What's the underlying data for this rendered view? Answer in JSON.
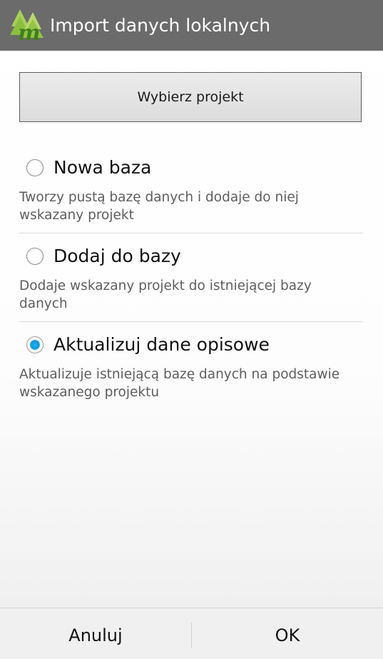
{
  "dialog": {
    "title": "Import danych lokalnych",
    "logo_icon": "trees-m-logo-icon",
    "choose_project_label": "Wybierz projekt"
  },
  "options": [
    {
      "label": "Nowa baza",
      "description": "Tworzy pustą bazę danych i dodaje do niej wskazany projekt",
      "checked": false
    },
    {
      "label": "Dodaj do bazy",
      "description": "Dodaje wskazany projekt do istniejącej bazy danych",
      "checked": false
    },
    {
      "label": "Aktualizuj dane opisowe",
      "description": "Aktualizuje istniejącą bazę danych na podstawie wskazanego projektu",
      "checked": true
    }
  ],
  "buttons": {
    "cancel_label": "Anuluj",
    "ok_label": "OK"
  },
  "colors": {
    "titlebar": "#6b6b6b",
    "radio_accent": "#0b93d8",
    "logo_green": "#7fb335",
    "logo_letter": "#3a7a1c"
  }
}
